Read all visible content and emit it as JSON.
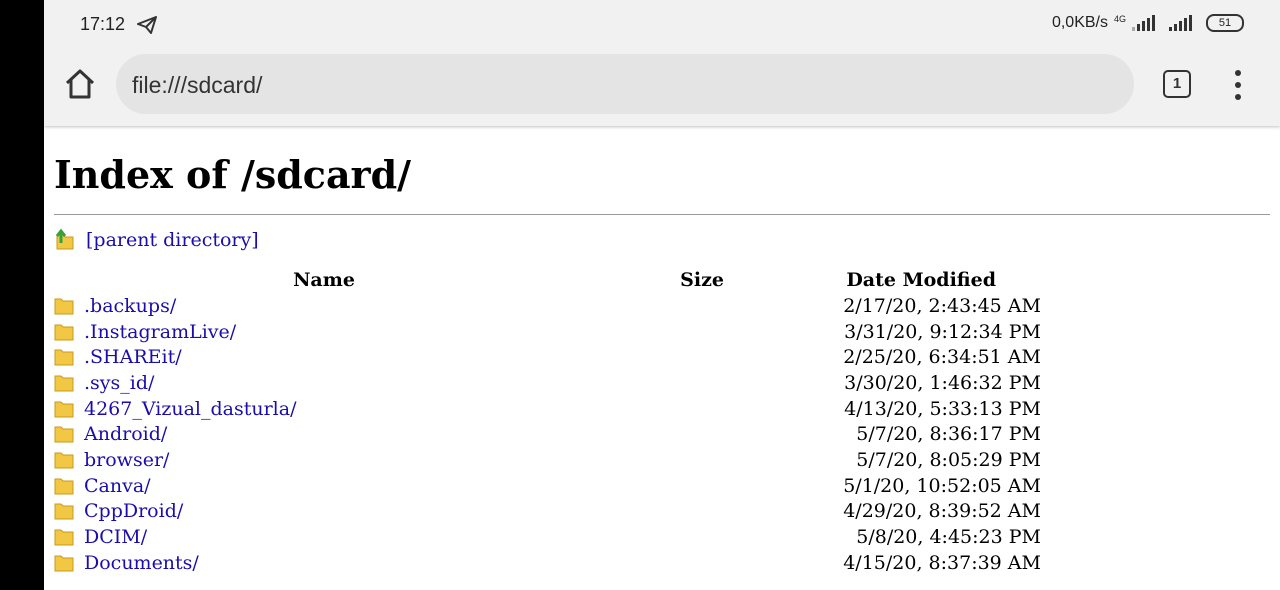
{
  "status_bar": {
    "time": "17:12",
    "network_speed": "0,0KB/s",
    "network_type": "4G",
    "battery": "51"
  },
  "toolbar": {
    "url": "file:///sdcard/",
    "tab_count": "1"
  },
  "page": {
    "heading": "Index of /sdcard/",
    "parent_link": "[parent directory]",
    "columns": {
      "name": "Name",
      "size": "Size",
      "date": "Date Modified"
    },
    "rows": [
      {
        "name": ".backups/",
        "size": "",
        "date": "2/17/20, 2:43:45 AM"
      },
      {
        "name": ".InstagramLive/",
        "size": "",
        "date": "3/31/20, 9:12:34 PM"
      },
      {
        "name": ".SHAREit/",
        "size": "",
        "date": "2/25/20, 6:34:51 AM"
      },
      {
        "name": ".sys_id/",
        "size": "",
        "date": "3/30/20, 1:46:32 PM"
      },
      {
        "name": "4267_Vizual_dasturla/",
        "size": "",
        "date": "4/13/20, 5:33:13 PM"
      },
      {
        "name": "Android/",
        "size": "",
        "date": "5/7/20, 8:36:17 PM"
      },
      {
        "name": "browser/",
        "size": "",
        "date": "5/7/20, 8:05:29 PM"
      },
      {
        "name": "Canva/",
        "size": "",
        "date": "5/1/20, 10:52:05 AM"
      },
      {
        "name": "CppDroid/",
        "size": "",
        "date": "4/29/20, 8:39:52 AM"
      },
      {
        "name": "DCIM/",
        "size": "",
        "date": "5/8/20, 4:45:23 PM"
      },
      {
        "name": "Documents/",
        "size": "",
        "date": "4/15/20, 8:37:39 AM"
      }
    ]
  },
  "colors": {
    "link": "#1a0dab",
    "folder": "#f2c744",
    "arrow": "#3aa03a"
  }
}
